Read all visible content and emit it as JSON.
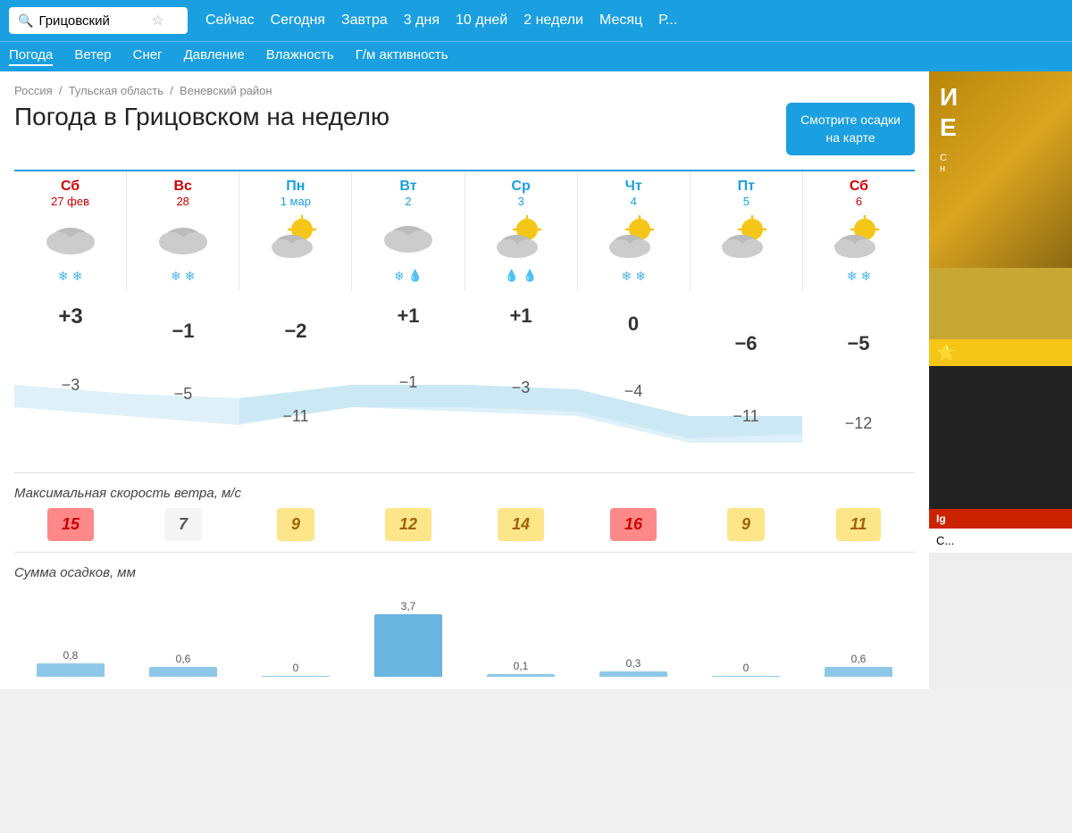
{
  "topnav": {
    "search_placeholder": "Грицовский",
    "nav_items": [
      "Сейчас",
      "Сегодня",
      "Завтра",
      "3 дня",
      "10 дней",
      "2 недели",
      "Месяц",
      "Р..."
    ]
  },
  "subnav": {
    "items": [
      "Погода",
      "Ветер",
      "Снег",
      "Давление",
      "Влажность",
      "Г/м активность"
    ]
  },
  "breadcrumb": {
    "parts": [
      "Россия",
      "Тульская область",
      "Веневский район"
    ]
  },
  "page": {
    "title": "Погода в Грицовском на неделю",
    "map_button": "Смотрите осадки\nна карте"
  },
  "days": [
    {
      "name": "Сб",
      "color": "red",
      "date": "27 фев",
      "precip": [
        "snow",
        "snow"
      ],
      "high": "+3",
      "low": "−3",
      "wind": 15,
      "wind_color": "red",
      "rain_mm": 0.8
    },
    {
      "name": "Вс",
      "color": "red",
      "date": "28",
      "precip": [
        "snow",
        "snow"
      ],
      "high": "−1",
      "low": "−5",
      "wind": 7,
      "wind_color": "light",
      "rain_mm": 0.6
    },
    {
      "name": "Пн",
      "color": "blue",
      "date": "1 мар",
      "precip": [],
      "high": "−2",
      "low": "−11",
      "wind": 9,
      "wind_color": "yellow",
      "rain_mm": 0
    },
    {
      "name": "Вт",
      "color": "blue",
      "date": "2",
      "precip": [
        "snow",
        "rain"
      ],
      "high": "+1",
      "low": "−1",
      "wind": 12,
      "wind_color": "yellow",
      "rain_mm": 3.7
    },
    {
      "name": "Ср",
      "color": "blue",
      "date": "3",
      "precip": [
        "rain",
        "rain"
      ],
      "high": "+1",
      "low": "−3",
      "wind": 14,
      "wind_color": "yellow",
      "rain_mm": 0.1
    },
    {
      "name": "Чт",
      "color": "blue",
      "date": "4",
      "precip": [
        "snow",
        "snow"
      ],
      "high": "0",
      "low": "−4",
      "wind": 16,
      "wind_color": "red",
      "rain_mm": 0.3
    },
    {
      "name": "Пт",
      "color": "blue",
      "date": "5",
      "precip": [],
      "high": "−6",
      "low": "−11",
      "wind": 9,
      "wind_color": "yellow",
      "rain_mm": 0
    },
    {
      "name": "Сб",
      "color": "red",
      "date": "6",
      "precip": [
        "snow",
        "snow"
      ],
      "high": "−5",
      "low": "−12",
      "wind": 11,
      "wind_color": "yellow",
      "rain_mm": 0.6
    }
  ],
  "sections": {
    "wind_label": "Максимальная скорость ветра, м/с",
    "precip_label": "Сумма осадков, мм"
  }
}
